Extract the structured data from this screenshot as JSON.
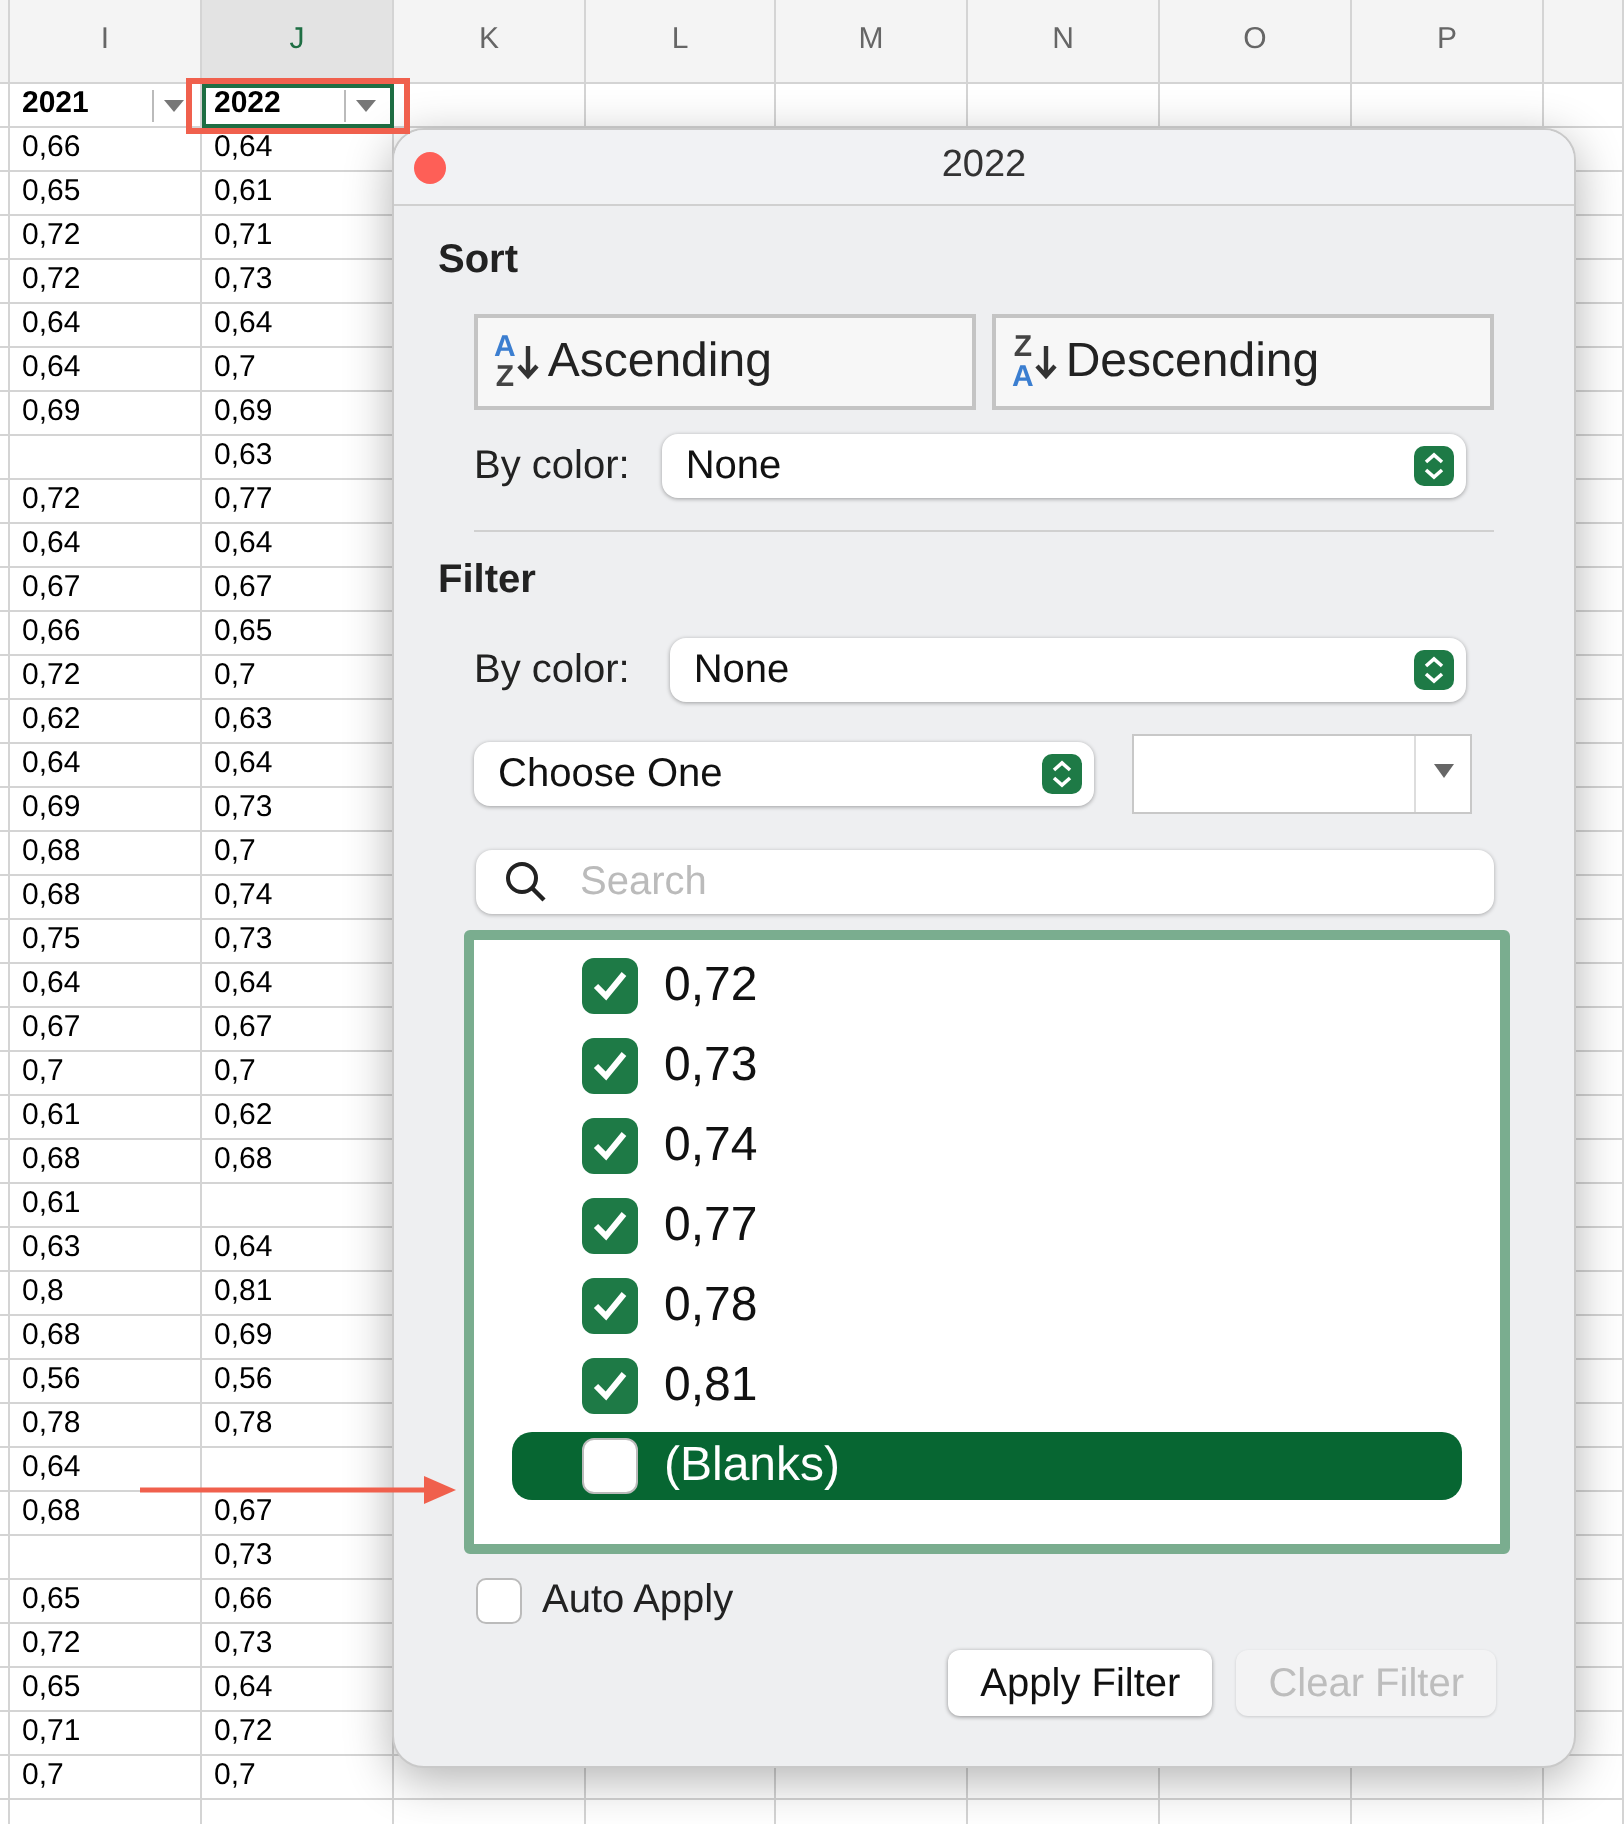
{
  "sheet": {
    "columns": [
      {
        "label": "I",
        "selected": false
      },
      {
        "label": "J",
        "selected": true
      },
      {
        "label": "K",
        "selected": false
      },
      {
        "label": "L",
        "selected": false
      },
      {
        "label": "M",
        "selected": false
      },
      {
        "label": "N",
        "selected": false
      },
      {
        "label": "O",
        "selected": false
      },
      {
        "label": "P",
        "selected": false
      }
    ],
    "header_cells": [
      {
        "text": "2021",
        "selected": false
      },
      {
        "text": "2022",
        "selected": true
      }
    ],
    "rows": [
      {
        "I": "0,66",
        "J": "0,64"
      },
      {
        "I": "0,65",
        "J": "0,61"
      },
      {
        "I": "0,72",
        "J": "0,71"
      },
      {
        "I": "0,72",
        "J": "0,73"
      },
      {
        "I": "0,64",
        "J": "0,64"
      },
      {
        "I": "0,64",
        "J": "0,7"
      },
      {
        "I": "0,69",
        "J": "0,69"
      },
      {
        "J": "0,63"
      },
      {
        "I": "0,72",
        "J": "0,77"
      },
      {
        "I": "0,64",
        "J": "0,64"
      },
      {
        "I": "0,67",
        "J": "0,67"
      },
      {
        "I": "0,66",
        "J": "0,65"
      },
      {
        "I": "0,72",
        "J": "0,7"
      },
      {
        "I": "0,62",
        "J": "0,63"
      },
      {
        "I": "0,64",
        "J": "0,64"
      },
      {
        "I": "0,69",
        "J": "0,73"
      },
      {
        "I": "0,68",
        "J": "0,7"
      },
      {
        "I": "0,68",
        "J": "0,74"
      },
      {
        "I": "0,75",
        "J": "0,73"
      },
      {
        "I": "0,64",
        "J": "0,64"
      },
      {
        "I": "0,67",
        "J": "0,67"
      },
      {
        "I": "0,7",
        "J": "0,7"
      },
      {
        "I": "0,61",
        "J": "0,62"
      },
      {
        "I": "0,68",
        "J": "0,68"
      },
      {
        "I": "0,61"
      },
      {
        "I": "0,63",
        "J": "0,64"
      },
      {
        "I": "0,8",
        "J": "0,81"
      },
      {
        "I": "0,68",
        "J": "0,69"
      },
      {
        "I": "0,56",
        "J": "0,56"
      },
      {
        "I": "0,78",
        "J": "0,78"
      },
      {
        "I": "0,64"
      },
      {
        "I": "0,68",
        "J": "0,67"
      },
      {
        "J": "0,73"
      },
      {
        "I": "0,65",
        "J": "0,66"
      },
      {
        "I": "0,72",
        "J": "0,73"
      },
      {
        "I": "0,65",
        "J": "0,64"
      },
      {
        "I": "0,71",
        "J": "0,72"
      },
      {
        "I": "0,7",
        "J": "0,7"
      }
    ]
  },
  "filter_popup": {
    "title": "2022",
    "sort": {
      "heading": "Sort",
      "buttons": [
        {
          "label": "Ascending",
          "kind": "ascending",
          "icon_top": "A",
          "icon_bottom": "Z"
        },
        {
          "label": "Descending",
          "kind": "descending",
          "icon_top": "Z",
          "icon_bottom": "A"
        }
      ],
      "by_color_label": "By color:",
      "by_color_value": "None"
    },
    "filter": {
      "heading": "Filter",
      "by_color_label": "By color:",
      "by_color_value": "None",
      "condition": "Choose One",
      "search_placeholder": "Search",
      "items": [
        {
          "label": "0,72",
          "checked": true,
          "selected": false
        },
        {
          "label": "0,73",
          "checked": true,
          "selected": false
        },
        {
          "label": "0,74",
          "checked": true,
          "selected": false
        },
        {
          "label": "0,77",
          "checked": true,
          "selected": false
        },
        {
          "label": "0,78",
          "checked": true,
          "selected": false
        },
        {
          "label": "0,81",
          "checked": true,
          "selected": false
        },
        {
          "label": "(Blanks)",
          "checked": false,
          "selected": true
        }
      ]
    },
    "auto_apply": {
      "label": "Auto Apply",
      "checked": false
    },
    "buttons": [
      {
        "label": "Apply Filter",
        "disabled": false
      },
      {
        "label": "Clear Filter",
        "disabled": true
      }
    ]
  }
}
